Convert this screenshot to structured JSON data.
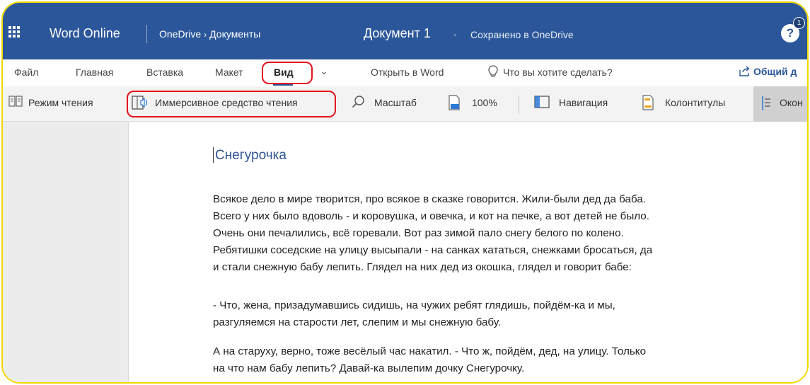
{
  "titlebar": {
    "app_name": "Word Online",
    "breadcrumb_root": "OneDrive",
    "breadcrumb_chevron": "›",
    "breadcrumb_folder": "Документы",
    "doc_title": "Документ 1",
    "doc_dash": "-",
    "save_status": "Сохранено в OneDrive",
    "notifications_count": "1",
    "bar_color": "#2b579a"
  },
  "menu": {
    "tabs": [
      "Файл",
      "Главная",
      "Вставка",
      "Макет",
      "Вид"
    ],
    "active_tab": "Вид",
    "open_in_word": "Открыть в Word",
    "tell_me": "Что вы хотите сделать?",
    "share": "Общий д"
  },
  "ribbon": {
    "reading_mode": "Режим чтения",
    "immersive_reader": "Иммерсивное средство чтения",
    "zoom": "Масштаб",
    "zoom_level": "100%",
    "navigation": "Навигация",
    "headers_footers": "Колонтитулы",
    "window": "Окон"
  },
  "document": {
    "title": "Снегурочка",
    "paragraphs": [
      [
        "Всякое дело в мире творится, про всякое в сказке говорится. Жили-были дед да баба.",
        "Всего у них было вдоволь - и коровушка, и овечка, и кот на печке, а вот детей не было.",
        "Очень они печалились, всё горевали. Вот раз зимой пало снегу белого по колено.",
        "Ребятишки соседские на улицу высыпали - на санках кататься, снежками бросаться, да",
        "и стали снежную бабу лепить. Глядел на них дед из окошка, глядел и говорит бабе:"
      ],
      [
        "- Что, жена, призадумавшись сидишь, на чужих ребят глядишь, пойдём-ка и мы,",
        "разгуляемся на старости лет, слепим и мы снежную бабу."
      ],
      [
        "А на старуху, верно, тоже весёлый час накатил. - Что ж, пойдём, дед, на улицу. Только",
        "на что нам бабу лепить? Давай-ка вылепим дочку Снегурочку."
      ]
    ]
  },
  "colors": {
    "highlight": "#e3141b",
    "accent": "#2b579a",
    "frame": "#f4d800"
  }
}
